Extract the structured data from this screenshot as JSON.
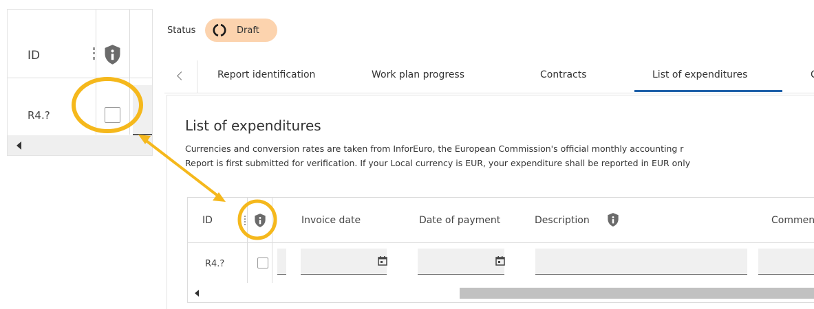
{
  "zoom_panel": {
    "header_id": "ID",
    "row_id": "R4.?"
  },
  "status": {
    "label": "Status",
    "value": "Draft"
  },
  "tabs": [
    {
      "label": "Report identification"
    },
    {
      "label": "Work plan progress"
    },
    {
      "label": "Contracts"
    },
    {
      "label": "List of expenditures",
      "active": true
    }
  ],
  "section": {
    "title": "List of expenditures",
    "desc_line1": "Currencies and conversion rates are taken from InforEuro, the European Commission's official monthly accounting r",
    "desc_line2": "Report is first submitted for verification. If your Local currency is EUR, your expenditure shall be reported in EUR only"
  },
  "grid": {
    "columns": [
      "ID",
      "Invoice date",
      "Date of payment",
      "Description",
      "Commen"
    ],
    "row": {
      "id": "R4.?"
    }
  },
  "colors": {
    "highlight": "#f5b81c",
    "status_badge": "#fcd3ae",
    "active_tab": "#1f61a9",
    "shield_icon": "#6b6b6b"
  }
}
